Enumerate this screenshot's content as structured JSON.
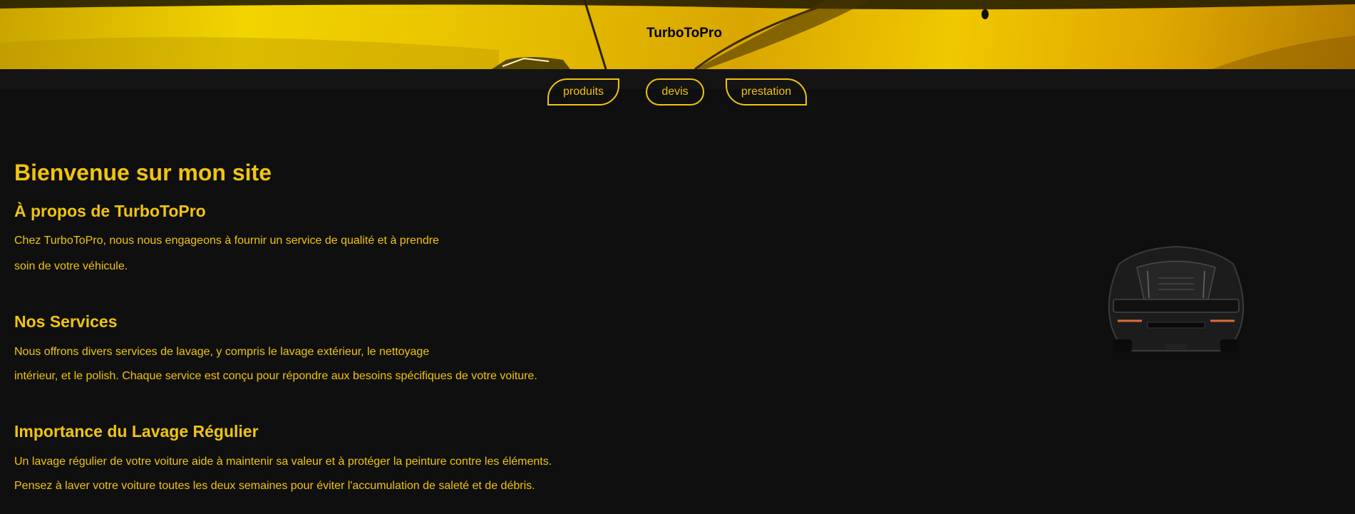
{
  "header": {
    "site_title": "TurboToPro"
  },
  "nav": {
    "items": [
      "produits",
      "devis",
      "prestation"
    ]
  },
  "main": {
    "welcome_heading": "Bienvenue sur mon site",
    "sections": [
      {
        "heading": "À propos de TurboToPro",
        "lines": [
          "Chez TurboToPro, nous nous engageons à fournir un service de qualité et à prendre",
          "soin de votre véhicule."
        ]
      },
      {
        "heading": "Nos Services",
        "lines": [
          "Nous offrons divers services de lavage, y compris le lavage extérieur, le nettoyage",
          "intérieur, et le polish. Chaque service est conçu pour répondre aux besoins spécifiques de votre voiture."
        ]
      },
      {
        "heading": "Importance du Lavage Régulier",
        "lines": [
          "Un lavage régulier de votre voiture aide à maintenir sa valeur et à protéger la peinture contre les éléments.",
          "Pensez à laver votre voiture toutes les deux semaines pour éviter l'accumulation de saleté et de débris."
        ]
      }
    ]
  },
  "colors": {
    "accent": "#f1c40f",
    "background": "#0f0f0f",
    "navbar": "#141414"
  },
  "icons": {
    "hero": "yellow-car-hero-image",
    "car": "black-car-rear-image"
  }
}
